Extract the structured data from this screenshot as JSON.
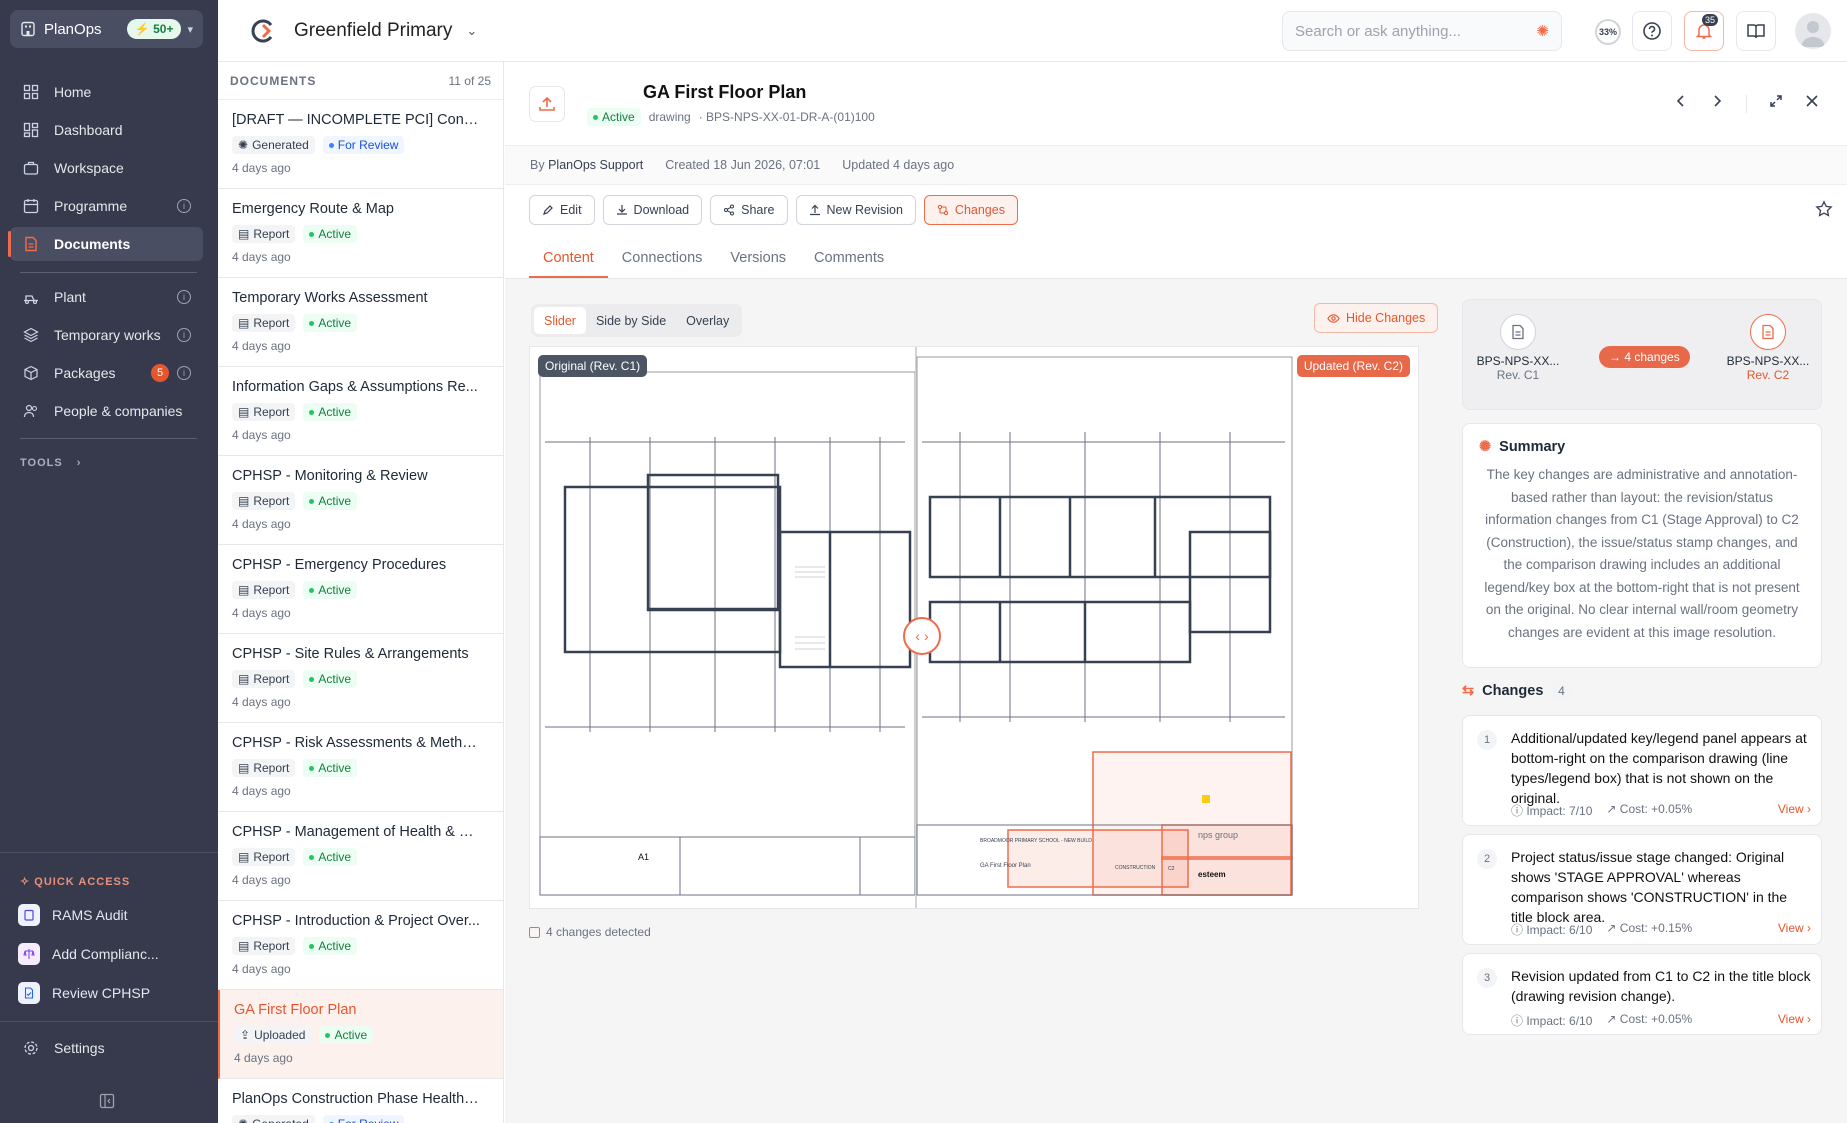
{
  "org": {
    "name": "PlanOps",
    "badge": "50+"
  },
  "nav": [
    {
      "label": "Home"
    },
    {
      "label": "Dashboard"
    },
    {
      "label": "Workspace"
    },
    {
      "label": "Programme"
    },
    {
      "label": "Documents"
    },
    {
      "label": "Plant"
    },
    {
      "label": "Temporary works"
    },
    {
      "label": "Packages",
      "count": "5"
    },
    {
      "label": "People & companies"
    }
  ],
  "tools_label": "TOOLS",
  "quick_access": {
    "title": "QUICK ACCESS",
    "items": [
      {
        "label": "RAMS Audit"
      },
      {
        "label": "Add Complianc..."
      },
      {
        "label": "Review CPHSP"
      }
    ]
  },
  "settings_label": "Settings",
  "topbar": {
    "project": "Greenfield Primary",
    "search_placeholder": "Search or ask anything...",
    "progress": "33%",
    "notifications": "35"
  },
  "doclist": {
    "title": "DOCUMENTS",
    "count": "11 of 25",
    "items": [
      {
        "title": "[DRAFT — INCOMPLETE PCI] Cons...",
        "type": "Generated",
        "status": "For Review",
        "date": "4 days ago"
      },
      {
        "title": "Emergency Route & Map",
        "type": "Report",
        "status": "Active",
        "date": "4 days ago"
      },
      {
        "title": "Temporary Works Assessment",
        "type": "Report",
        "status": "Active",
        "date": "4 days ago"
      },
      {
        "title": "Information Gaps & Assumptions Re...",
        "type": "Report",
        "status": "Active",
        "date": "4 days ago"
      },
      {
        "title": "CPHSP - Monitoring & Review",
        "type": "Report",
        "status": "Active",
        "date": "4 days ago"
      },
      {
        "title": "CPHSP - Emergency Procedures",
        "type": "Report",
        "status": "Active",
        "date": "4 days ago"
      },
      {
        "title": "CPHSP - Site Rules & Arrangements",
        "type": "Report",
        "status": "Active",
        "date": "4 days ago"
      },
      {
        "title": "CPHSP - Risk Assessments & Metho...",
        "type": "Report",
        "status": "Active",
        "date": "4 days ago"
      },
      {
        "title": "CPHSP - Management of Health & S...",
        "type": "Report",
        "status": "Active",
        "date": "4 days ago"
      },
      {
        "title": "CPHSP - Introduction & Project Over...",
        "type": "Report",
        "status": "Active",
        "date": "4 days ago"
      },
      {
        "title": "GA First Floor Plan",
        "type": "Uploaded",
        "status": "Active",
        "date": "4 days ago"
      },
      {
        "title": "PlanOps Construction Phase Health ...",
        "type": "Generated",
        "status": "For Review",
        "date": ""
      }
    ]
  },
  "document": {
    "title": "GA First Floor Plan",
    "status": "Active",
    "kind": "drawing",
    "ref": "· BPS-NPS-XX-01-DR-A-(01)100",
    "by_prefix": "By",
    "by_name": "PlanOps Support",
    "created": "Created 18 Jun 2026, 07:01",
    "updated": "Updated 4 days ago"
  },
  "actions": {
    "edit": "Edit",
    "download": "Download",
    "share": "Share",
    "new_revision": "New Revision",
    "changes": "Changes"
  },
  "tabs": [
    "Content",
    "Connections",
    "Versions",
    "Comments"
  ],
  "compare": {
    "modes": [
      "Slider",
      "Side by Side",
      "Overlay"
    ],
    "hide_changes": "Hide Changes",
    "original_label": "Original (Rev. C1)",
    "updated_label": "Updated (Rev. C2)",
    "detected": "4 changes detected",
    "drawing_text": {
      "a1": "A1",
      "title": "GA First Floor Plan",
      "client": "BROADMOOR PRIMARY SCHOOL - NEW BUILD",
      "stage": "CONSTRUCTION",
      "rev": "C2",
      "group": "nps group",
      "logo": "esteem"
    }
  },
  "revisions": {
    "from_name": "BPS-NPS-XX...",
    "from_rev": "Rev. C1",
    "to_name": "BPS-NPS-XX...",
    "to_rev": "Rev. C2",
    "changes_pill": "→ 4 changes"
  },
  "summary": {
    "title": "Summary",
    "text": "The key changes are administrative and annotation-based rather than layout: the revision/status information changes from C1 (Stage Approval) to C2 (Construction), the issue/status stamp changes, and the comparison drawing includes an additional legend/key box at the bottom-right that is not present on the original. No clear internal wall/room geometry changes are evident at this image resolution."
  },
  "changes": {
    "title": "Changes",
    "count": "4",
    "items": [
      {
        "n": "1",
        "text": "Additional/updated key/legend panel appears at bottom-right on the comparison drawing (line types/legend box) that is not shown on the original.",
        "impact": "Impact: 7/10",
        "cost": "Cost: +0.05%",
        "view": "View ›"
      },
      {
        "n": "2",
        "text": "Project status/issue stage changed: Original shows 'STAGE APPROVAL' whereas comparison shows 'CONSTRUCTION' in the title block area.",
        "impact": "Impact: 6/10",
        "cost": "Cost: +0.15%",
        "view": "View ›"
      },
      {
        "n": "3",
        "text": "Revision updated from C1 to C2 in the title block (drawing revision change).",
        "impact": "Impact: 6/10",
        "cost": "Cost: +0.05%",
        "view": "View ›"
      }
    ]
  },
  "colors": {
    "accent": "#e4572e",
    "sidebar": "#373a4d",
    "active_green": "#15803d"
  }
}
